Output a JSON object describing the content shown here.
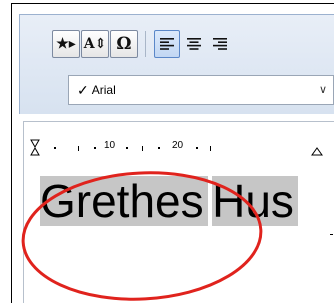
{
  "toolbar": {
    "buttons": [
      {
        "icon": "star-insert-icon",
        "glyph": "★▸"
      },
      {
        "icon": "font-size-icon",
        "glyph": "A⇕"
      },
      {
        "icon": "omega-symbol-icon",
        "glyph": "Ω"
      }
    ],
    "align_buttons": [
      "align-left-icon",
      "align-center-icon",
      "align-right-icon"
    ]
  },
  "font": {
    "check": "✓",
    "name": "Arial",
    "chevron": "∨"
  },
  "ruler": {
    "labels": [
      "10",
      "20"
    ]
  },
  "document": {
    "lines": [
      "Grethes",
      "Hus"
    ],
    "selection_color": "#c6c6c6"
  },
  "annotation": {
    "ellipse_color": "#e0231d"
  }
}
